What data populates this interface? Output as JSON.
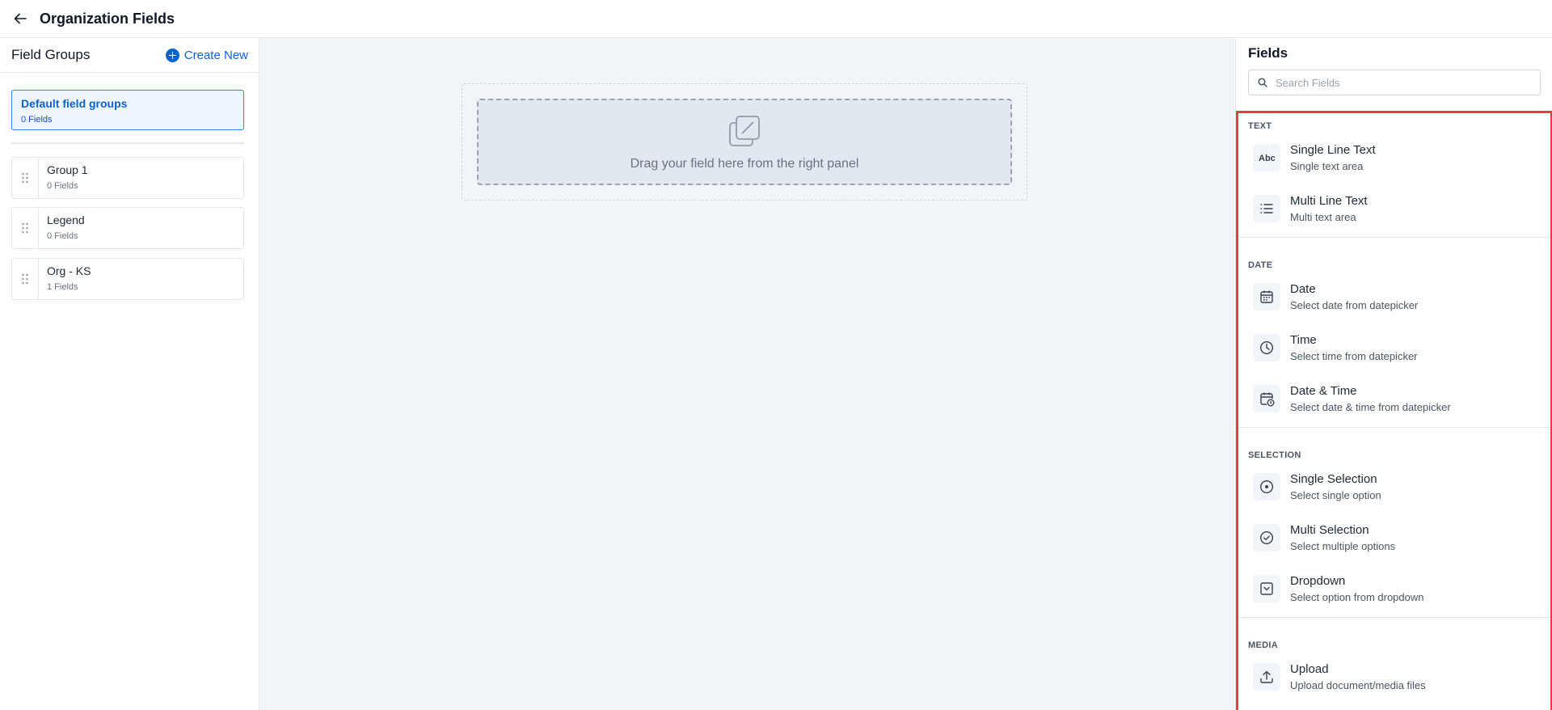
{
  "header": {
    "title": "Organization Fields"
  },
  "left_panel": {
    "title": "Field Groups",
    "create_label": "Create New",
    "default_group": {
      "name": "Default field groups",
      "count": "0 Fields"
    },
    "groups": [
      {
        "name": "Group 1",
        "count": "0 Fields"
      },
      {
        "name": "Legend",
        "count": "0 Fields"
      },
      {
        "name": "Org - KS",
        "count": "1 Fields"
      }
    ]
  },
  "canvas": {
    "drop_text": "Drag your field here from the right panel"
  },
  "right_panel": {
    "title": "Fields",
    "search_placeholder": "Search Fields",
    "sections": [
      {
        "label": "TEXT",
        "items": [
          {
            "title": "Single Line Text",
            "desc": "Single text area",
            "icon": "abc-icon"
          },
          {
            "title": "Multi Line Text",
            "desc": "Multi text area",
            "icon": "list-icon"
          }
        ]
      },
      {
        "label": "DATE",
        "items": [
          {
            "title": "Date",
            "desc": "Select date from datepicker",
            "icon": "calendar-icon"
          },
          {
            "title": "Time",
            "desc": "Select time from datepicker",
            "icon": "clock-icon"
          },
          {
            "title": "Date & Time",
            "desc": "Select date & time from datepicker",
            "icon": "calendar-clock-icon"
          }
        ]
      },
      {
        "label": "SELECTION",
        "items": [
          {
            "title": "Single Selection",
            "desc": "Select single option",
            "icon": "radio-icon"
          },
          {
            "title": "Multi Selection",
            "desc": "Select multiple options",
            "icon": "check-circle-icon"
          },
          {
            "title": "Dropdown",
            "desc": "Select option from dropdown",
            "icon": "dropdown-icon"
          }
        ]
      },
      {
        "label": "MEDIA",
        "items": [
          {
            "title": "Upload",
            "desc": "Upload document/media files",
            "icon": "upload-icon"
          }
        ]
      }
    ]
  },
  "colors": {
    "accent": "#0b63ce",
    "highlight_border": "#e04040",
    "canvas_bg": "#f1f5f9"
  }
}
